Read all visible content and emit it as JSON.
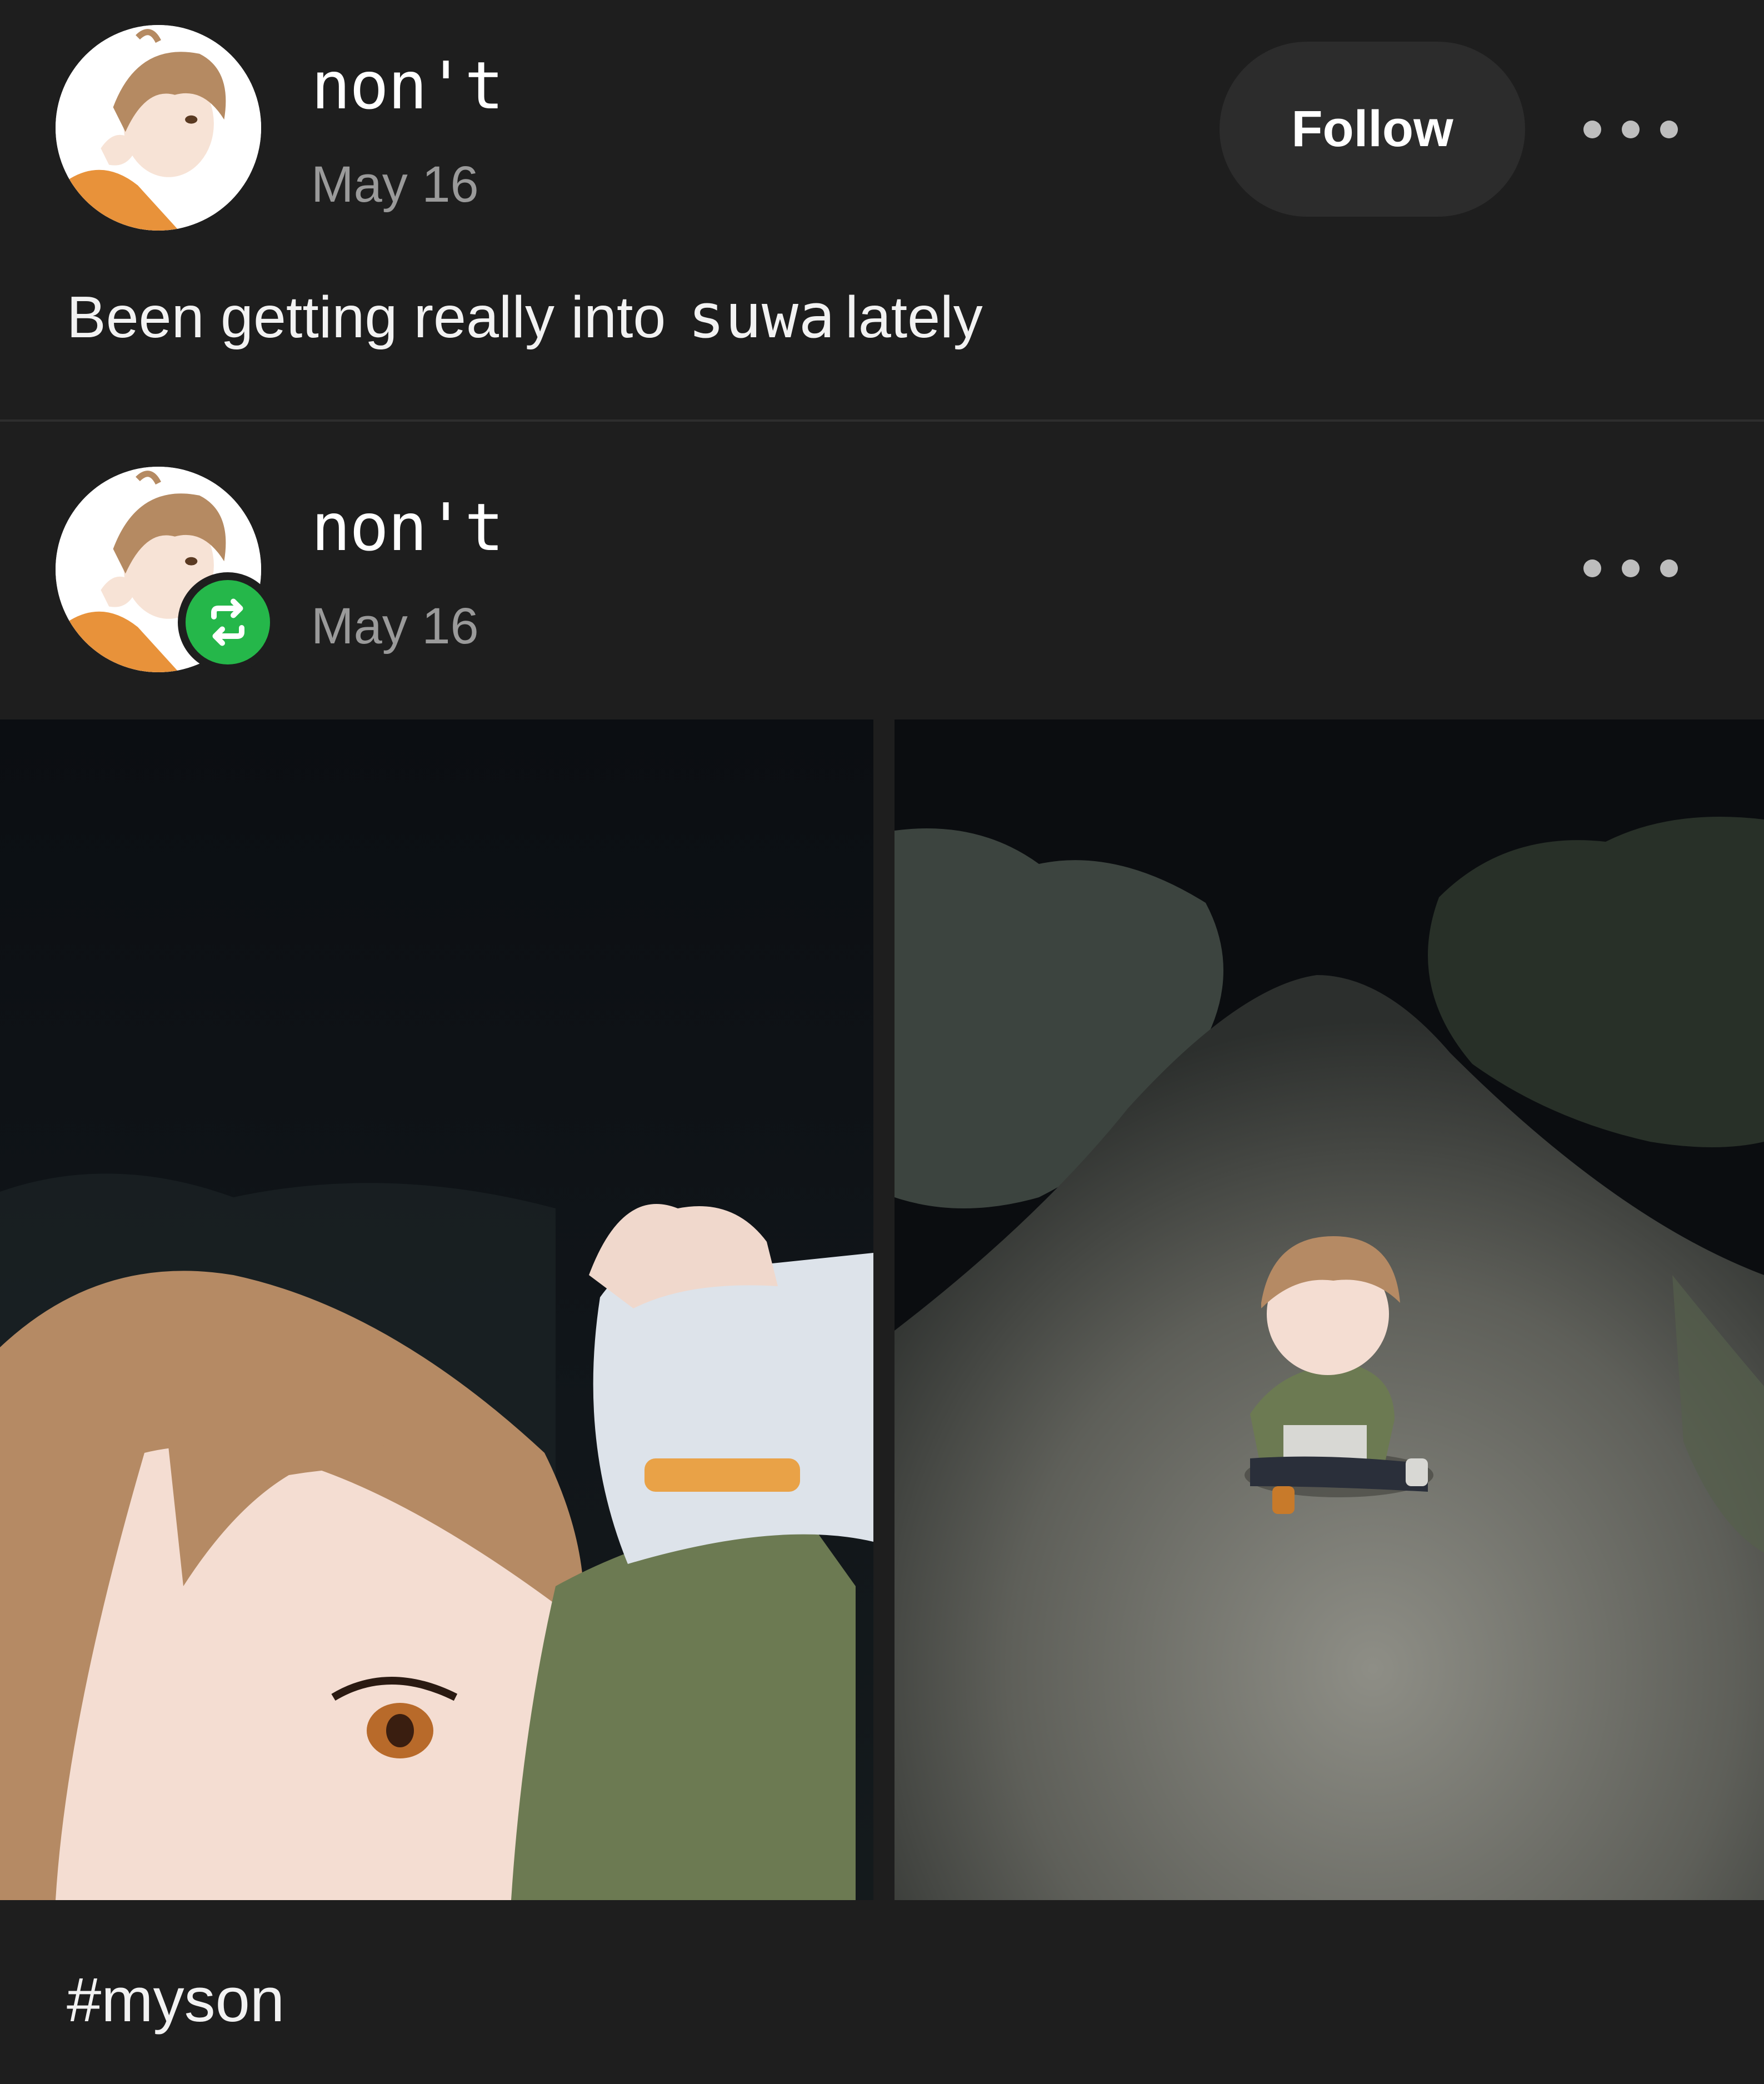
{
  "original_post": {
    "username": "non't",
    "date": "May 16",
    "follow_label": "Follow",
    "text_before": "Been getting really into",
    "text_handwritten": "suwa",
    "text_after": "lately"
  },
  "reblog": {
    "username": "non't",
    "date": "May 16",
    "tag": "#myson"
  },
  "colors": {
    "background": "#1e1e1e",
    "follow_button": "#2c2c2c",
    "reblog_badge": "#25b74a",
    "date_text": "#9a9a9a"
  }
}
